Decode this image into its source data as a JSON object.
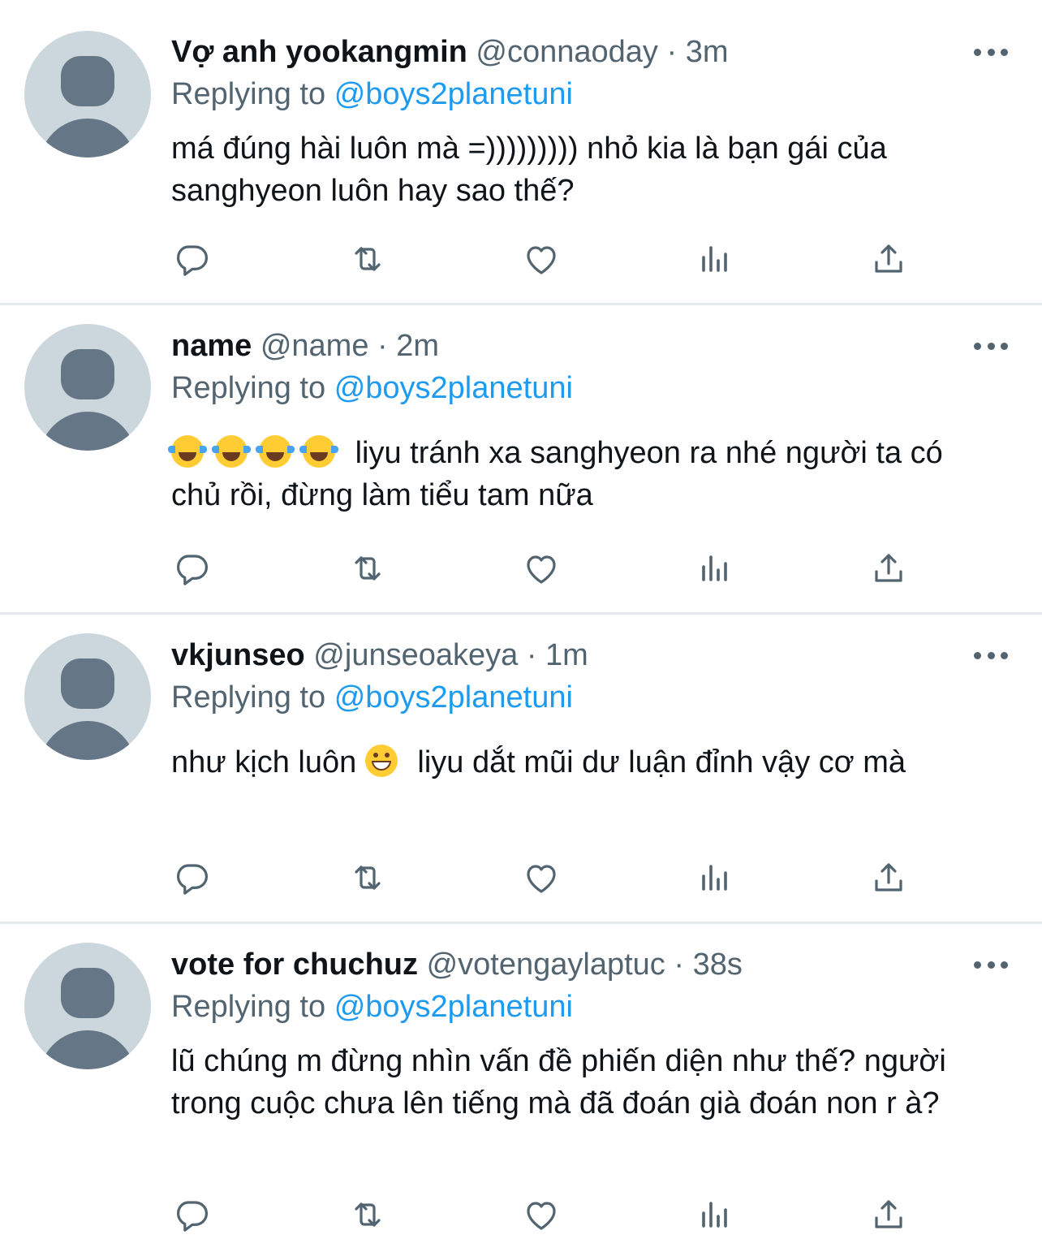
{
  "tweets": [
    {
      "name": "Vợ anh yookangmin",
      "handle": "@connaoday",
      "separator": "·",
      "time": "3m",
      "replying_prefix": "Replying to",
      "replying_to": "@boys2planetuni",
      "text_parts": [
        "",
        "má đúng hài luôn mà =))))))))) nhỏ kia là bạn gái của sanghyeon luôn hay sao thế?"
      ]
    },
    {
      "name": "name",
      "handle": "@name",
      "separator": "·",
      "time": "2m",
      "replying_prefix": "Replying to",
      "replying_to": "@boys2planetuni",
      "text_parts": [
        "",
        "liyu tránh xa sanghyeon ra nhé người ta có chủ rồi, đừng làm tiểu tam nữa"
      ]
    },
    {
      "name": "vkjunseo",
      "handle": "@junseoakeya",
      "separator": "·",
      "time": "1m",
      "replying_prefix": "Replying to",
      "replying_to": "@boys2planetuni",
      "text_parts": [
        "như kịch luôn",
        "liyu dắt mũi dư luận đỉnh vậy cơ mà"
      ]
    },
    {
      "name": "vote for chuchuz",
      "handle": "@votengaylaptuc",
      "separator": "·",
      "time": "38s",
      "replying_prefix": "Replying to",
      "replying_to": "@boys2planetuni",
      "text_parts": [
        "",
        "lũ chúng m đừng nhìn vấn đề phiến diện như thế? người trong cuộc chưa lên tiếng mà đã đoán già đoán non r à?"
      ]
    }
  ],
  "icons": {
    "reply": "reply-icon",
    "retweet": "retweet-icon",
    "like": "like-icon",
    "views": "views-icon",
    "share": "share-icon",
    "more": "more-icon",
    "avatar": "default-avatar-icon",
    "emoji_tears": "face-with-tears-of-joy-icon",
    "emoji_grin": "grinning-face-icon"
  },
  "colors": {
    "text": "#0f1419",
    "secondary": "#536471",
    "link": "#1d9bf0",
    "avatar_bg": "#ccd6dd",
    "avatar_fg": "#657786",
    "divider": "#e6e9ec"
  }
}
